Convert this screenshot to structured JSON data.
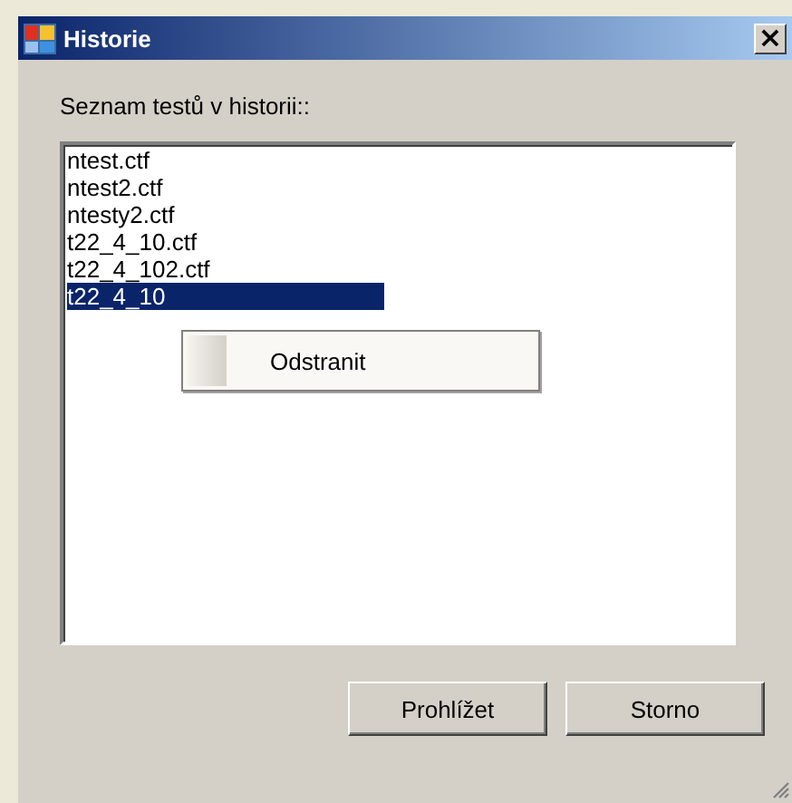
{
  "window": {
    "title": "Historie",
    "close": "×"
  },
  "label": "Seznam testů v historii::",
  "list": [
    {
      "text": "ntest.ctf",
      "selected": false
    },
    {
      "text": "ntest2.ctf",
      "selected": false
    },
    {
      "text": "ntesty2.ctf",
      "selected": false
    },
    {
      "text": "t22_4_10.ctf",
      "selected": false
    },
    {
      "text": "t22_4_102.ctf",
      "selected": false
    },
    {
      "text": "t22_4_10",
      "selected": true
    }
  ],
  "context_menu": {
    "items": [
      "Odstranit"
    ]
  },
  "buttons": [
    "Prohlížet",
    "Storno"
  ]
}
